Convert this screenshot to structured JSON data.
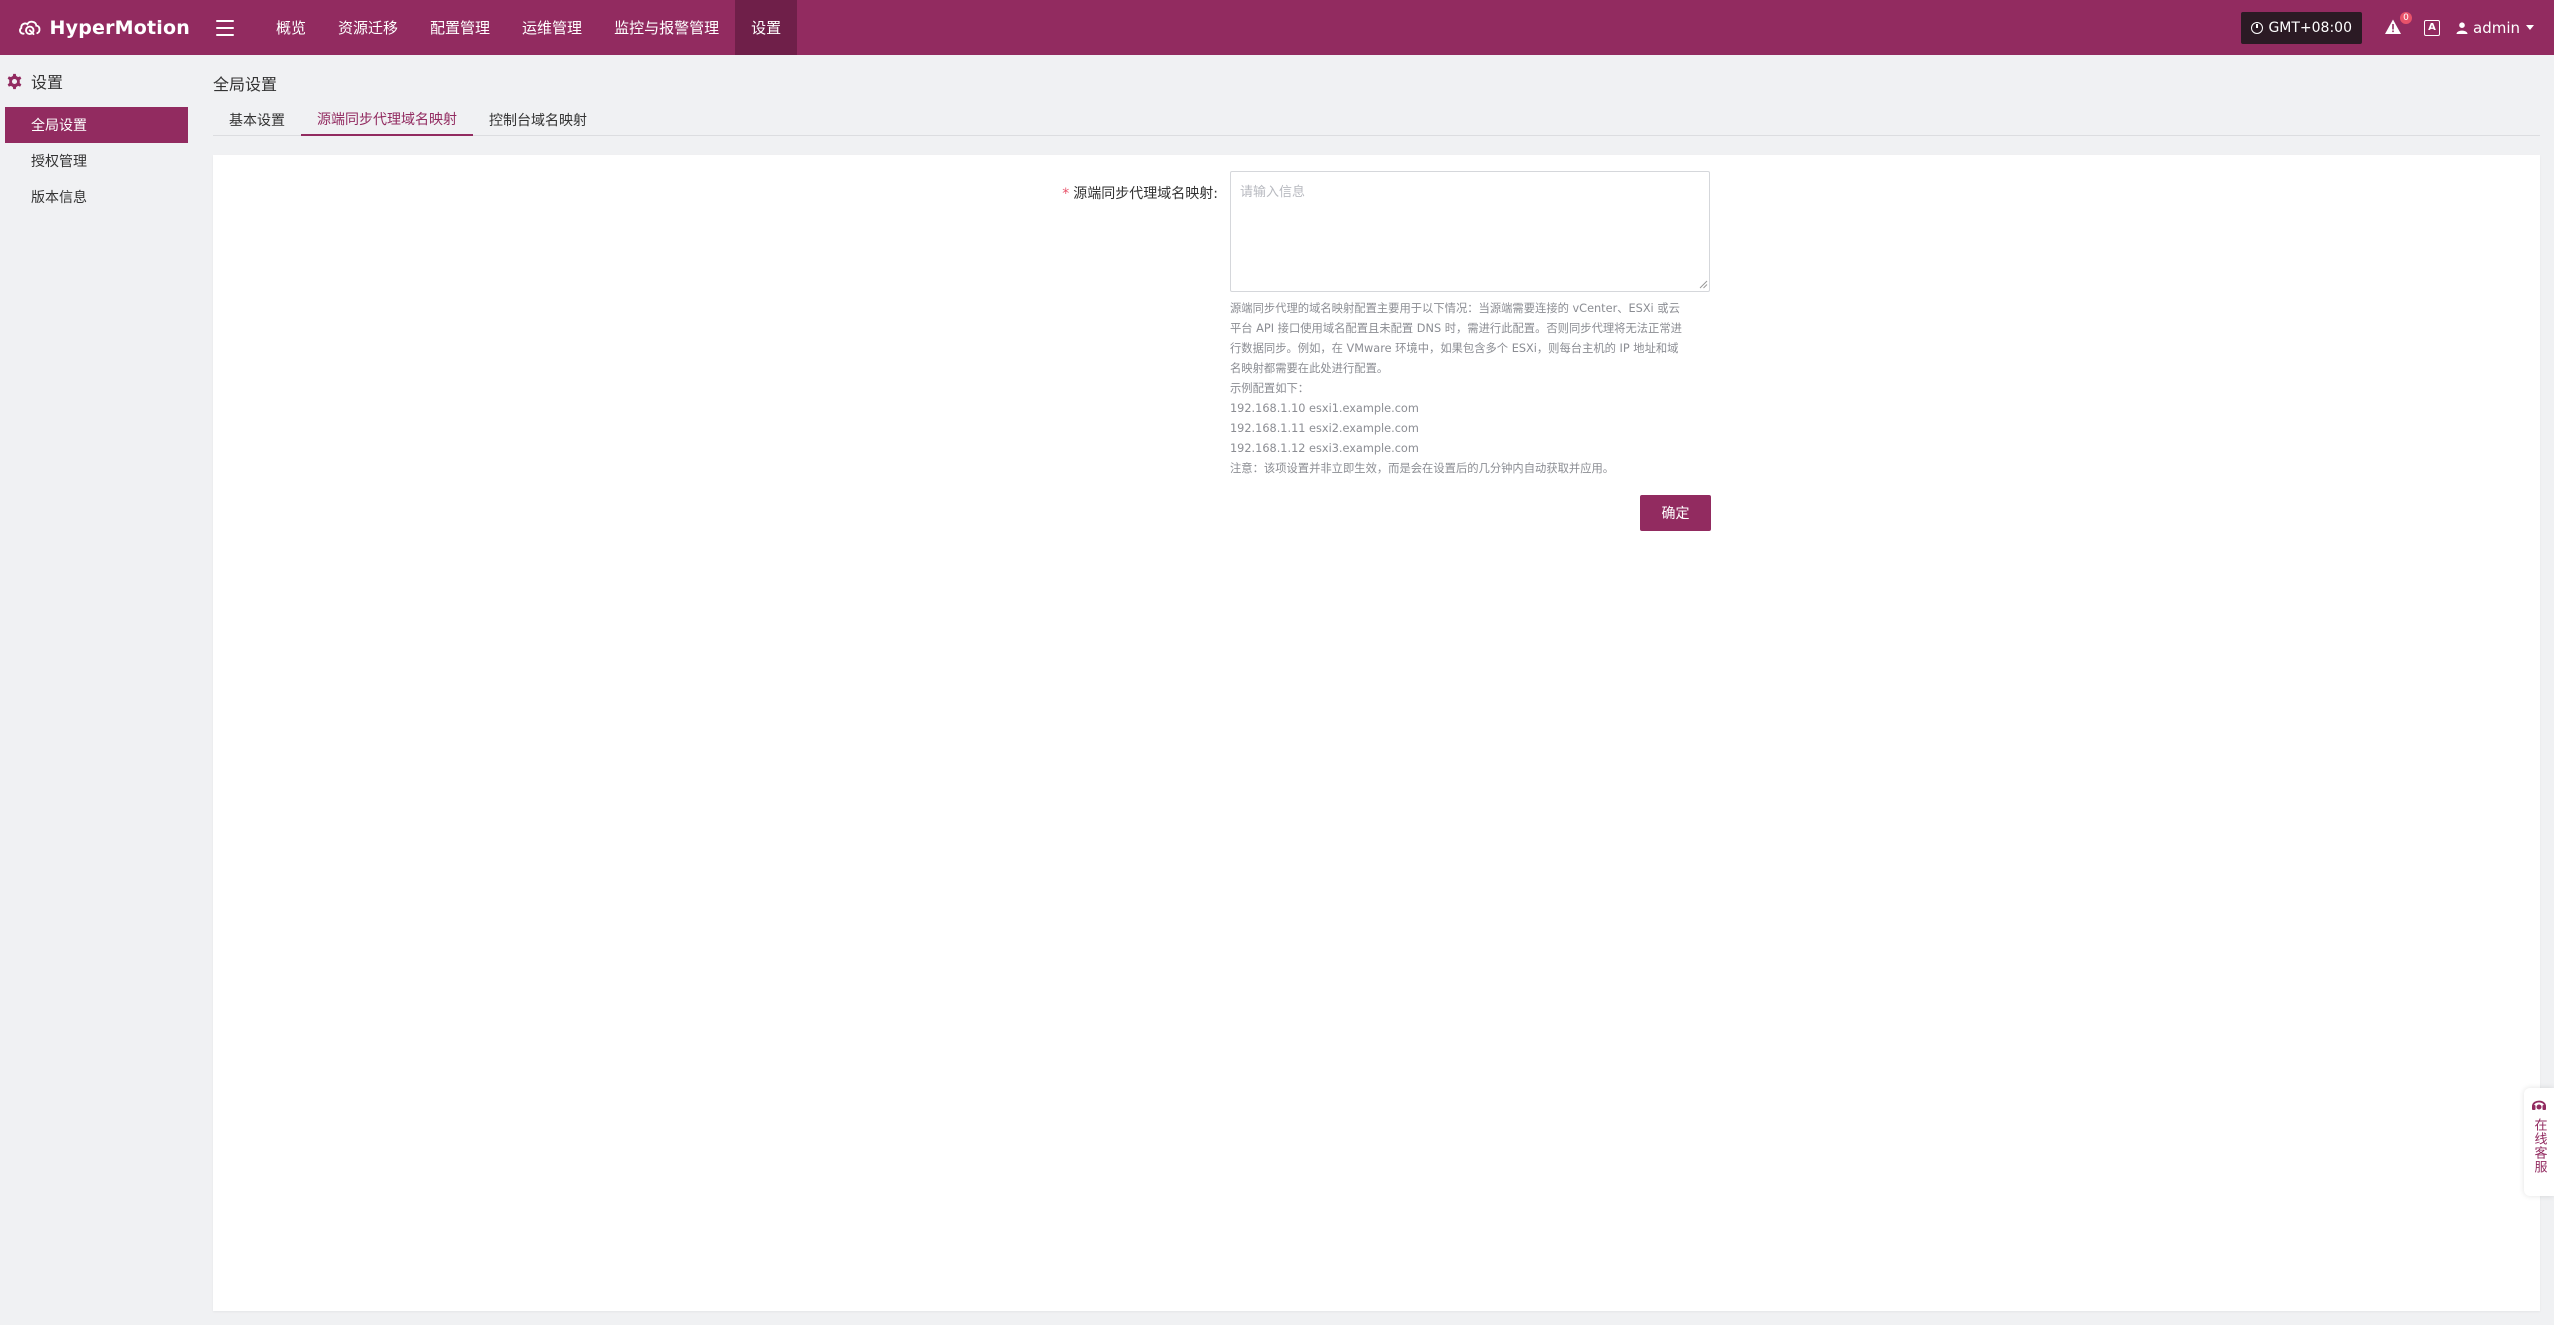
{
  "app": {
    "name": "HyperMotion"
  },
  "topnav": {
    "items": [
      {
        "label": "概览"
      },
      {
        "label": "资源迁移"
      },
      {
        "label": "配置管理"
      },
      {
        "label": "运维管理"
      },
      {
        "label": "监控与报警管理"
      },
      {
        "label": "设置"
      }
    ],
    "timezone": "GMT+08:00",
    "alert_count": "0",
    "lang_label": "A",
    "user": "admin"
  },
  "sidebar": {
    "header": "设置",
    "items": [
      {
        "label": "全局设置"
      },
      {
        "label": "授权管理"
      },
      {
        "label": "版本信息"
      }
    ]
  },
  "main": {
    "title": "全局设置",
    "tabs": [
      {
        "label": "基本设置"
      },
      {
        "label": "源端同步代理域名映射"
      },
      {
        "label": "控制台域名映射"
      }
    ],
    "form": {
      "required_mark": "*",
      "label": "源端同步代理域名映射:",
      "value": "",
      "placeholder": "请输入信息",
      "help": [
        "源端同步代理的域名映射配置主要用于以下情况：当源端需要连接的 vCenter、ESXi 或云",
        "平台 API 接口使用域名配置且未配置 DNS 时，需进行此配置。否则同步代理将无法正常进",
        "行数据同步。例如，在 VMware 环境中，如果包含多个 ESXi，则每台主机的 IP 地址和域",
        "名映射都需要在此处进行配置。",
        "示例配置如下：",
        "192.168.1.10 esxi1.example.com",
        "192.168.1.11 esxi2.example.com",
        "192.168.1.12 esxi3.example.com",
        "注意：该项设置并非立即生效，而是会在设置后的几分钟内自动获取并应用。"
      ],
      "submit": "确定"
    }
  },
  "service": {
    "label": "在线客服"
  },
  "colors": {
    "brand": "#922b60",
    "nav_active": "#6f1f49",
    "badge": "#e8526a"
  }
}
